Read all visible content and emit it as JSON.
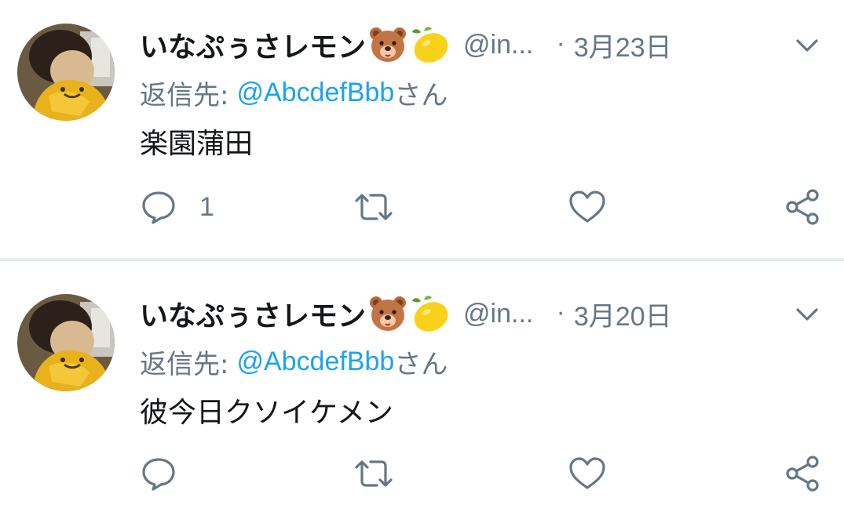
{
  "colors": {
    "secondary_text": "#657786",
    "link": "#1da1f2",
    "primary_text": "#14171a",
    "divider": "#e6ecf0"
  },
  "tweets": [
    {
      "display_name": "いなぷぅさレモン",
      "emojis": [
        "bear-face-emoji",
        "lemon-emoji"
      ],
      "handle": "@in...",
      "separator": "·",
      "date": "3月23日",
      "reply_prefix": "返信先:",
      "reply_handle": "@AbcdefBbb",
      "reply_suffix": "さん",
      "text": "楽園蒲田",
      "reply_count": "1",
      "icons": [
        "reply-icon",
        "retweet-icon",
        "like-icon",
        "share-icon",
        "chevron-down-icon"
      ]
    },
    {
      "display_name": "いなぷぅさレモン",
      "emojis": [
        "bear-face-emoji",
        "lemon-emoji"
      ],
      "handle": "@in...",
      "separator": "·",
      "date": "3月20日",
      "reply_prefix": "返信先:",
      "reply_handle": "@AbcdefBbb",
      "reply_suffix": "さん",
      "text": "彼今日クソイケメン",
      "reply_count": "",
      "icons": [
        "reply-icon",
        "retweet-icon",
        "like-icon",
        "share-icon",
        "chevron-down-icon"
      ]
    }
  ]
}
